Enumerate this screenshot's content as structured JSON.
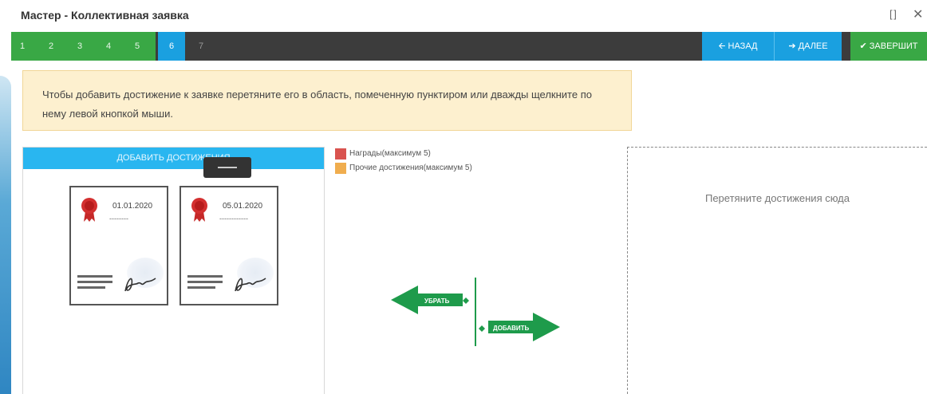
{
  "window": {
    "title": "Мастер - Коллективная заявка",
    "expand_icon": "expand-icon",
    "close_icon": "close-icon",
    "close_glyph": "✕"
  },
  "steps": {
    "items": [
      "1",
      "2",
      "3",
      "4",
      "5",
      "6",
      "7"
    ],
    "active": "6"
  },
  "nav": {
    "back_label": "НАЗАД",
    "next_label": "ДАЛЕЕ",
    "finish_label": "ЗАВЕРШИТ"
  },
  "info": {
    "text": "Чтобы добавить достижение к заявке перетяните его в область, помеченную пунктиром или дважды щелкните по нему левой кнопкой мыши."
  },
  "source": {
    "header": "ДОБАВИТЬ ДОСТИЖЕНИЯ",
    "cards": [
      {
        "date": "01.01.2020",
        "dash": "--------"
      },
      {
        "date": "05.01.2020",
        "dash": "------------"
      }
    ]
  },
  "legend": [
    {
      "label": "Награды(максимум 5)",
      "color": "#d9534f"
    },
    {
      "label": "Прочие достижения(максимум 5)",
      "color": "#f0ad4e"
    }
  ],
  "arrows": {
    "remove_label": "УБРАТЬ",
    "add_label": "ДОБАВИТЬ",
    "color": "#1e9b4b"
  },
  "dropzone": {
    "text": "Перетяните достижения сюда"
  },
  "colors": {
    "accent_blue": "#1aa0e0",
    "accent_green": "#39a845",
    "stepbar_dark": "#3c3c3c"
  }
}
